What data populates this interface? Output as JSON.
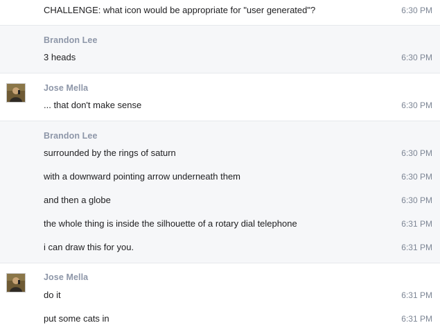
{
  "messages_top": {
    "text": "CHALLENGE: what icon would be appropriate for \"user generated\"?",
    "time": "6:30 PM"
  },
  "group1": {
    "sender": "Brandon Lee",
    "messages": [
      {
        "text": "3 heads",
        "time": "6:30 PM"
      }
    ]
  },
  "group2": {
    "sender": "Jose Mella",
    "messages": [
      {
        "text": "... that don't make sense",
        "time": "6:30 PM"
      }
    ]
  },
  "group3": {
    "sender": "Brandon Lee",
    "messages": [
      {
        "text": "surrounded by the rings of saturn",
        "time": "6:30 PM"
      },
      {
        "text": "with a downward pointing arrow underneath them",
        "time": "6:30 PM"
      },
      {
        "text": "and then a globe",
        "time": "6:30 PM"
      },
      {
        "text": "the whole thing is inside the silhouette of a rotary dial telephone",
        "time": "6:31 PM"
      },
      {
        "text": "i can draw this for you.",
        "time": "6:31 PM"
      }
    ]
  },
  "group4": {
    "sender": "Jose Mella",
    "messages": [
      {
        "text": "do it",
        "time": "6:31 PM"
      },
      {
        "text": "put some cats in",
        "time": "6:31 PM"
      }
    ]
  }
}
